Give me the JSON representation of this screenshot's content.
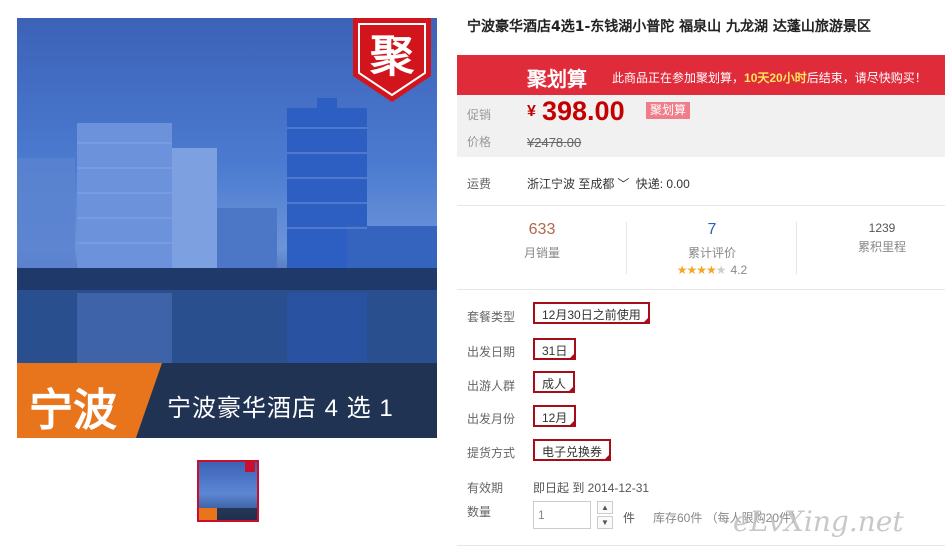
{
  "gallery": {
    "badge": "聚",
    "city": "宁波",
    "caption": "宁波豪华酒店 4 选 1"
  },
  "product": {
    "title": "宁波豪华酒店4选1-东钱湖小普陀 福泉山 九龙湖 达蓬山旅游景区"
  },
  "ju_bar": {
    "logo": "聚划算",
    "msg_pre": "此商品正在参加聚划算，",
    "msg_time": "10天20小时",
    "msg_post": "后结束，请尽快购买！"
  },
  "price": {
    "promo_label": "促销",
    "currency": "¥",
    "promo_price": "398.00",
    "promo_tag": "聚划算",
    "orig_label": "价格",
    "orig_price": "¥2478.00"
  },
  "shipping": {
    "label": "运费",
    "from": "浙江宁波",
    "to": "至成都",
    "chevron_icon": "chevron-down-icon",
    "express": "快递: 0.00"
  },
  "stats": {
    "sales": {
      "value": "633",
      "label": "月销量"
    },
    "reviews": {
      "value": "7",
      "label": "累计评价",
      "rating": "4.2",
      "stars": 4.2
    },
    "miles": {
      "value": "1239",
      "label": "累积里程"
    }
  },
  "options": {
    "package_label": "套餐类型",
    "package_value": "12月30日之前使用",
    "date_label": "出发日期",
    "date_value": "31日",
    "group_label": "出游人群",
    "group_value": "成人",
    "month_label": "出发月份",
    "month_value": "12月",
    "delivery_label": "提货方式",
    "delivery_value": "电子兑换券"
  },
  "validity": {
    "label": "有效期",
    "value": "即日起  到  2014-12-31"
  },
  "quantity": {
    "label": "数量",
    "value": "1",
    "unit": "件",
    "stock": "库存60件 （每人限购20件）"
  },
  "watermark": "eLvXing.net",
  "colors": {
    "accent": "#e02b3b",
    "price": "#c40000",
    "option_border": "#a50d18",
    "city_tag": "#e8741c"
  }
}
